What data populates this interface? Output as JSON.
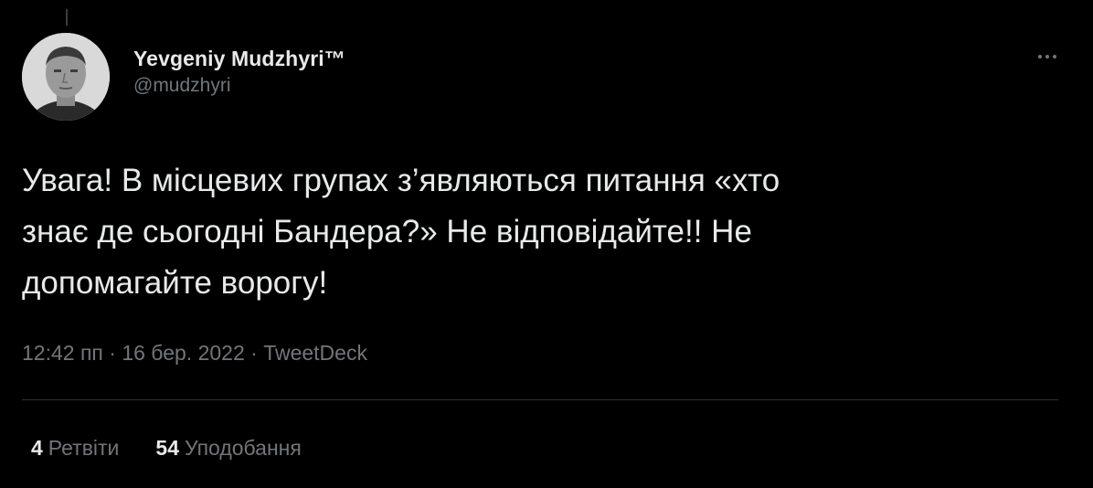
{
  "tweet": {
    "author": {
      "display_name": "Yevgeniy Mudzhyri™",
      "handle": "@mudzhyri",
      "avatar": "person-photo"
    },
    "more_icon": "more-horizontal-icon",
    "text": "Увага! В місцевих групах з’являються питання «хто\nзнає де сьогодні Бандера?» Не відповідайте!! Не\nдопомагайте ворогу!",
    "time": "12:42 пп",
    "separator": "·",
    "date": "16 бер. 2022",
    "source": "TweetDeck",
    "stats": {
      "retweets": {
        "count": "4",
        "label": "Ретвіти"
      },
      "likes": {
        "count": "54",
        "label": "Уподобання"
      }
    }
  },
  "colors": {
    "background": "#000000",
    "primary_text": "#e7e9ea",
    "secondary_text": "#71767b",
    "divider": "#2f3336"
  }
}
